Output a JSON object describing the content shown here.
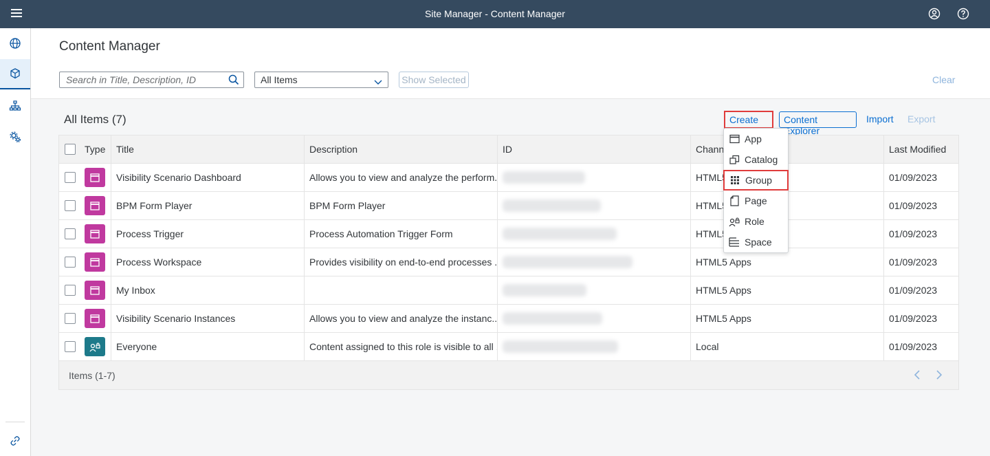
{
  "shell": {
    "title": "Site Manager - Content Manager"
  },
  "sidenav": {
    "items": [
      {
        "icon": "globe-icon"
      },
      {
        "icon": "box-icon"
      },
      {
        "icon": "hierarchy-icon"
      },
      {
        "icon": "gears-icon"
      }
    ],
    "bottom_icon": "link-icon"
  },
  "header": {
    "page_title": "Content Manager",
    "search_placeholder": "Search in Title, Description, ID",
    "filter_selected": "All Items",
    "show_selected_label": "Show Selected",
    "clear_label": "Clear"
  },
  "toolbar": {
    "title": "All Items (7)",
    "create_label": "Create",
    "content_explorer_label": "Content Explorer",
    "import_label": "Import",
    "export_label": "Export"
  },
  "create_menu": {
    "items": [
      "App",
      "Catalog",
      "Group",
      "Page",
      "Role",
      "Space"
    ],
    "highlighted": "Group"
  },
  "table": {
    "columns": [
      "Type",
      "Title",
      "Description",
      "ID",
      "Channel",
      "Last Modified"
    ],
    "column_channel_visible": "Chann",
    "rows": [
      {
        "type": "app",
        "title": "Visibility Scenario Dashboard",
        "description": "Allows you to view and analyze the perform...",
        "channel": "HTML5",
        "modified": "01/09/2023"
      },
      {
        "type": "app",
        "title": "BPM Form Player",
        "description": "BPM Form Player",
        "channel": "HTML5",
        "modified": "01/09/2023"
      },
      {
        "type": "app",
        "title": "Process Trigger",
        "description": "Process Automation Trigger Form",
        "channel": "HTML5",
        "modified": "01/09/2023"
      },
      {
        "type": "app",
        "title": "Process Workspace",
        "description": "Provides visibility on end-to-end processes ...",
        "channel": "HTML5 Apps",
        "modified": "01/09/2023"
      },
      {
        "type": "app",
        "title": "My Inbox",
        "description": "",
        "channel": "HTML5 Apps",
        "modified": "01/09/2023"
      },
      {
        "type": "app",
        "title": "Visibility Scenario Instances",
        "description": "Allows you to view and analyze the instanc...",
        "channel": "HTML5 Apps",
        "modified": "01/09/2023"
      },
      {
        "type": "role",
        "title": "Everyone",
        "description": "Content assigned to this role is visible to all ...",
        "channel": "Local",
        "modified": "01/09/2023"
      }
    ],
    "footer": "Items (1-7)"
  },
  "colors": {
    "shell_bg": "#354a5f",
    "app_icon_bg": "#c0399f",
    "role_icon_bg": "#1d7a8a",
    "link_blue": "#0a6ed1",
    "highlight_red": "#e03b3b"
  }
}
